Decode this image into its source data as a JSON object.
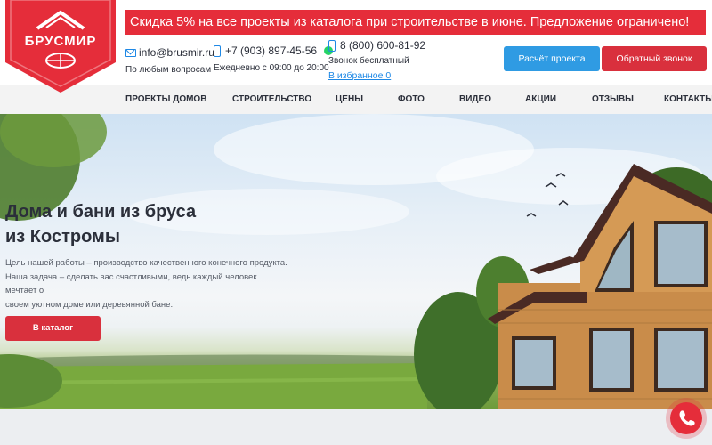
{
  "brand": {
    "name": "БРУСМИР",
    "accent": "#e52d3a",
    "blue": "#2f9be3"
  },
  "promo": {
    "text": "Скидка 5% на все проекты из каталога при строительстве в июне. Предложение ограничено!"
  },
  "contacts": {
    "email": {
      "icon": "mail-icon",
      "value": "info@brusmir.ru",
      "note": "По любым вопросам"
    },
    "phone": {
      "icon": "phone-icon",
      "value": "+7 (903) 897-45-56",
      "note": "Ежедневно с 09:00 до 20:00",
      "messenger_icon": "whatsapp-icon"
    },
    "free_phone": {
      "icon": "phone-icon",
      "value": "8 (800) 600-81-92",
      "note": "Звонок бесплатный",
      "favorites_label": "В избранное 0"
    }
  },
  "buttons": {
    "calc_project": "Расчёт проекта",
    "callback": "Обратный звонок"
  },
  "nav": [
    "ПРОЕКТЫ ДОМОВ",
    "СТРОИТЕЛЬСТВО",
    "ЦЕНЫ",
    "ФОТО",
    "ВИДЕО",
    "АКЦИИ",
    "ОТЗЫВЫ",
    "КОНТАКТЫ"
  ],
  "hero": {
    "title_line1": "Дома и бани из бруса",
    "title_line2": "из Костромы",
    "text_line1": "Цель нашей работы – производство качественного конечного продукта.",
    "text_line2": "Наша задача – сделать вас счастливыми, ведь каждый человек мечтает о",
    "text_line3": "своем уютном доме или деревянной бане.",
    "cta": "В каталог"
  },
  "fab": {
    "icon": "phone-call-icon"
  }
}
